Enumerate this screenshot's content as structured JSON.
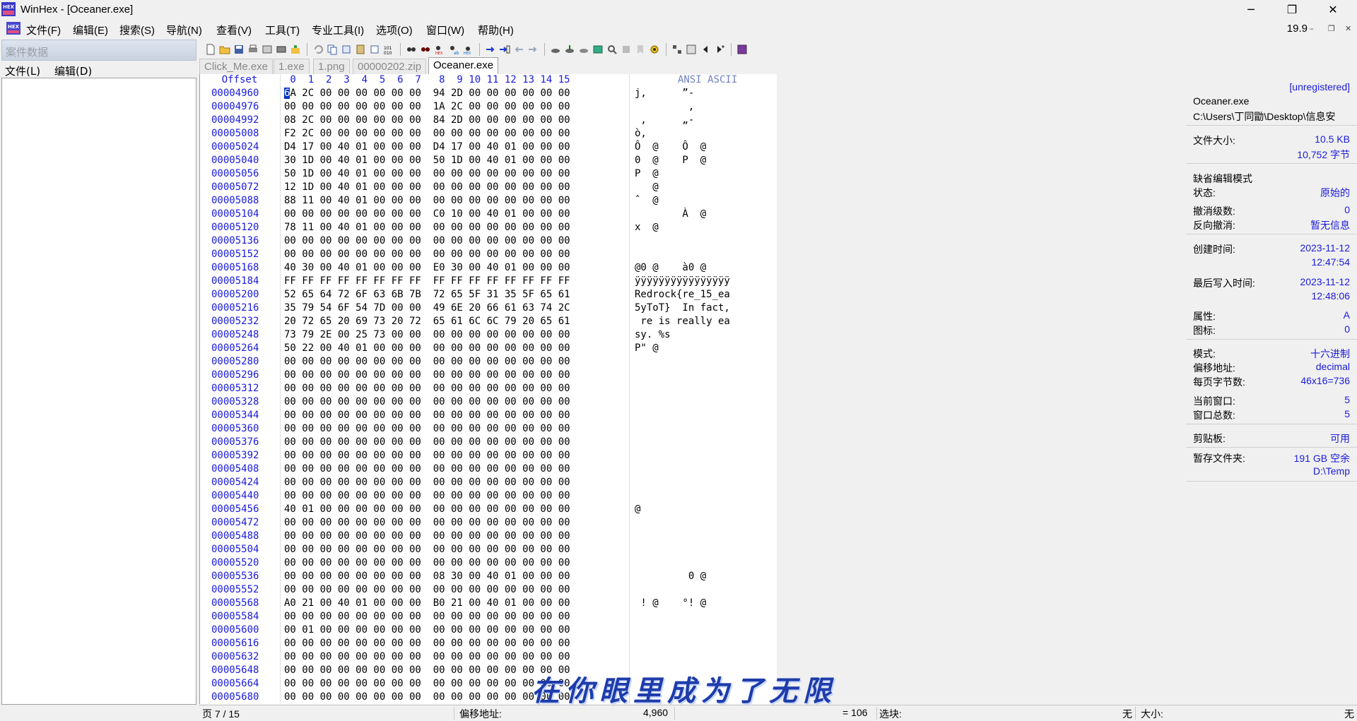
{
  "window": {
    "title": "WinHex - [Oceaner.exe]",
    "controls": [
      "─",
      "❐",
      "✕"
    ],
    "mdi_controls": [
      "–",
      "❐",
      "✕"
    ]
  },
  "menu": {
    "items": [
      "文件(F)",
      "编辑(E)",
      "搜索(S)",
      "导航(N)",
      "查看(V)",
      "工具(T)",
      "专业工具(I)",
      "选项(O)",
      "窗口(W)",
      "帮助(H)"
    ],
    "zoom": "19.9"
  },
  "case_panel": {
    "title": "案件数据",
    "menu": [
      "文件(L)",
      "编辑(D)"
    ]
  },
  "tabs": [
    "Click_Me.exe",
    "1.exe",
    "1.png",
    "00000202.zip",
    "Oceaner.exe"
  ],
  "hex_view": {
    "offset_header": "Offset",
    "column_header": " 0  1  2  3  4  5  6  7   8  9 10 11 12 13 14 15",
    "ascii_header": "ANSI ASCII",
    "rows": [
      {
        "offset": "00004960",
        "hex": "6A 2C 00 00 00 00 00 00  94 2D 00 00 00 00 00 00",
        "ascii": "j,      ”-      "
      },
      {
        "offset": "00004976",
        "hex": "00 00 00 00 00 00 00 00  1A 2C 00 00 00 00 00 00",
        "ascii": "         ,      "
      },
      {
        "offset": "00004992",
        "hex": "08 2C 00 00 00 00 00 00  84 2D 00 00 00 00 00 00",
        "ascii": " ,      „-      "
      },
      {
        "offset": "00005008",
        "hex": "F2 2C 00 00 00 00 00 00  00 00 00 00 00 00 00 00",
        "ascii": "ò,              "
      },
      {
        "offset": "00005024",
        "hex": "D4 17 00 40 01 00 00 00  D4 17 00 40 01 00 00 00",
        "ascii": "Ô  @    Ô  @    "
      },
      {
        "offset": "00005040",
        "hex": "30 1D 00 40 01 00 00 00  50 1D 00 40 01 00 00 00",
        "ascii": "0  @    P  @    "
      },
      {
        "offset": "00005056",
        "hex": "50 1D 00 40 01 00 00 00  00 00 00 00 00 00 00 00",
        "ascii": "P  @            "
      },
      {
        "offset": "00005072",
        "hex": "12 1D 00 40 01 00 00 00  00 00 00 00 00 00 00 00",
        "ascii": "   @            "
      },
      {
        "offset": "00005088",
        "hex": "88 11 00 40 01 00 00 00  00 00 00 00 00 00 00 00",
        "ascii": "ˆ  @            "
      },
      {
        "offset": "00005104",
        "hex": "00 00 00 00 00 00 00 00  C0 10 00 40 01 00 00 00",
        "ascii": "        À  @    "
      },
      {
        "offset": "00005120",
        "hex": "78 11 00 40 01 00 00 00  00 00 00 00 00 00 00 00",
        "ascii": "x  @            "
      },
      {
        "offset": "00005136",
        "hex": "00 00 00 00 00 00 00 00  00 00 00 00 00 00 00 00",
        "ascii": ""
      },
      {
        "offset": "00005152",
        "hex": "00 00 00 00 00 00 00 00  00 00 00 00 00 00 00 00",
        "ascii": ""
      },
      {
        "offset": "00005168",
        "hex": "40 30 00 40 01 00 00 00  E0 30 00 40 01 00 00 00",
        "ascii": "@0 @    à0 @    "
      },
      {
        "offset": "00005184",
        "hex": "FF FF FF FF FF FF FF FF  FF FF FF FF FF FF FF FF",
        "ascii": "ÿÿÿÿÿÿÿÿÿÿÿÿÿÿÿÿ"
      },
      {
        "offset": "00005200",
        "hex": "52 65 64 72 6F 63 6B 7B  72 65 5F 31 35 5F 65 61",
        "ascii": "Redrock{re_15_ea"
      },
      {
        "offset": "00005216",
        "hex": "35 79 54 6F 54 7D 00 00  49 6E 20 66 61 63 74 2C",
        "ascii": "5yToT}  In fact,"
      },
      {
        "offset": "00005232",
        "hex": "20 72 65 20 69 73 20 72  65 61 6C 6C 79 20 65 61",
        "ascii": " re is really ea"
      },
      {
        "offset": "00005248",
        "hex": "73 79 2E 00 25 73 00 00  00 00 00 00 00 00 00 00",
        "ascii": "sy. %s          "
      },
      {
        "offset": "00005264",
        "hex": "50 22 00 40 01 00 00 00  00 00 00 00 00 00 00 00",
        "ascii": "P\" @            "
      },
      {
        "offset": "00005280",
        "hex": "00 00 00 00 00 00 00 00  00 00 00 00 00 00 00 00",
        "ascii": ""
      },
      {
        "offset": "00005296",
        "hex": "00 00 00 00 00 00 00 00  00 00 00 00 00 00 00 00",
        "ascii": ""
      },
      {
        "offset": "00005312",
        "hex": "00 00 00 00 00 00 00 00  00 00 00 00 00 00 00 00",
        "ascii": ""
      },
      {
        "offset": "00005328",
        "hex": "00 00 00 00 00 00 00 00  00 00 00 00 00 00 00 00",
        "ascii": ""
      },
      {
        "offset": "00005344",
        "hex": "00 00 00 00 00 00 00 00  00 00 00 00 00 00 00 00",
        "ascii": ""
      },
      {
        "offset": "00005360",
        "hex": "00 00 00 00 00 00 00 00  00 00 00 00 00 00 00 00",
        "ascii": ""
      },
      {
        "offset": "00005376",
        "hex": "00 00 00 00 00 00 00 00  00 00 00 00 00 00 00 00",
        "ascii": ""
      },
      {
        "offset": "00005392",
        "hex": "00 00 00 00 00 00 00 00  00 00 00 00 00 00 00 00",
        "ascii": ""
      },
      {
        "offset": "00005408",
        "hex": "00 00 00 00 00 00 00 00  00 00 00 00 00 00 00 00",
        "ascii": ""
      },
      {
        "offset": "00005424",
        "hex": "00 00 00 00 00 00 00 00  00 00 00 00 00 00 00 00",
        "ascii": ""
      },
      {
        "offset": "00005440",
        "hex": "00 00 00 00 00 00 00 00  00 00 00 00 00 00 00 00",
        "ascii": ""
      },
      {
        "offset": "00005456",
        "hex": "40 01 00 00 00 00 00 00  00 00 00 00 00 00 00 00",
        "ascii": "@               "
      },
      {
        "offset": "00005472",
        "hex": "00 00 00 00 00 00 00 00  00 00 00 00 00 00 00 00",
        "ascii": ""
      },
      {
        "offset": "00005488",
        "hex": "00 00 00 00 00 00 00 00  00 00 00 00 00 00 00 00",
        "ascii": ""
      },
      {
        "offset": "00005504",
        "hex": "00 00 00 00 00 00 00 00  00 00 00 00 00 00 00 00",
        "ascii": ""
      },
      {
        "offset": "00005520",
        "hex": "00 00 00 00 00 00 00 00  00 00 00 00 00 00 00 00",
        "ascii": ""
      },
      {
        "offset": "00005536",
        "hex": "00 00 00 00 00 00 00 00  08 30 00 40 01 00 00 00",
        "ascii": "         0 @    "
      },
      {
        "offset": "00005552",
        "hex": "00 00 00 00 00 00 00 00  00 00 00 00 00 00 00 00",
        "ascii": ""
      },
      {
        "offset": "00005568",
        "hex": "A0 21 00 40 01 00 00 00  B0 21 00 40 01 00 00 00",
        "ascii": " ! @    °! @    "
      },
      {
        "offset": "00005584",
        "hex": "00 00 00 00 00 00 00 00  00 00 00 00 00 00 00 00",
        "ascii": ""
      },
      {
        "offset": "00005600",
        "hex": "00 01 00 00 00 00 00 00  00 00 00 00 00 00 00 00",
        "ascii": ""
      },
      {
        "offset": "00005616",
        "hex": "00 00 00 00 00 00 00 00  00 00 00 00 00 00 00 00",
        "ascii": ""
      },
      {
        "offset": "00005632",
        "hex": "00 00 00 00 00 00 00 00  00 00 00 00 00 00 00 00",
        "ascii": ""
      },
      {
        "offset": "00005648",
        "hex": "00 00 00 00 00 00 00 00  00 00 00 00 00 00 00 00",
        "ascii": ""
      },
      {
        "offset": "00005664",
        "hex": "00 00 00 00 00 00 00 00  00 00 00 00 00 00 00 00",
        "ascii": ""
      },
      {
        "offset": "00005680",
        "hex": "00 00 00 00 00 00 00 00  00 00 00 00 00 00 00 00",
        "ascii": ""
      }
    ]
  },
  "info_panel": {
    "registration": "[unregistered]",
    "file_name": "Oceaner.exe",
    "file_path": "C:\\Users\\丁同勖\\Desktop\\信息安",
    "file_size_label": "文件大小:",
    "file_size_kb": "10.5 KB",
    "file_size_bytes": "10,752 字节",
    "edit_mode": "缺省编辑模式",
    "state_label": "状态:",
    "state_value": "原始的",
    "undo_level_label": "撤消级数:",
    "undo_level_value": "0",
    "reverse_undo_label": "反向撤消:",
    "reverse_undo_value": "暂无信息",
    "created_label": "创建时间:",
    "created_date": "2023-11-12",
    "created_time": "12:47:54",
    "modified_label": "最后写入时间:",
    "modified_date": "2023-11-12",
    "modified_time": "12:48:06",
    "attr_label": "属性:",
    "attr_value": "A",
    "icon_label": "图标:",
    "icon_value": "0",
    "mode_label": "模式:",
    "mode_value": "十六进制",
    "offset_label": "偏移地址:",
    "offset_value": "decimal",
    "bytes_per_page_label": "每页字节数:",
    "bytes_per_page_value": "46x16=736",
    "current_window_label": "当前窗口:",
    "current_window_value": "5",
    "total_windows_label": "窗口总数:",
    "total_windows_value": "5",
    "clipboard_label": "剪贴板:",
    "clipboard_value": "可用",
    "temp_label": "暂存文件夹:",
    "temp_space": "191 GB 空余",
    "temp_path": "D:\\Temp"
  },
  "status": {
    "page": "页 7 / 15",
    "offset_label": "偏移地址:",
    "offset_value": "4,960",
    "byte_value": "= 106",
    "selection_label": "选块:",
    "selection_value": "无",
    "size_label": "大小:",
    "size_value": "无"
  },
  "watermark": "在你眼里成为了无限",
  "colors": {
    "offset_blue": "#1a1adc",
    "cursor_bg": "#0030c8",
    "info_value_blue": "#1a1adc"
  }
}
